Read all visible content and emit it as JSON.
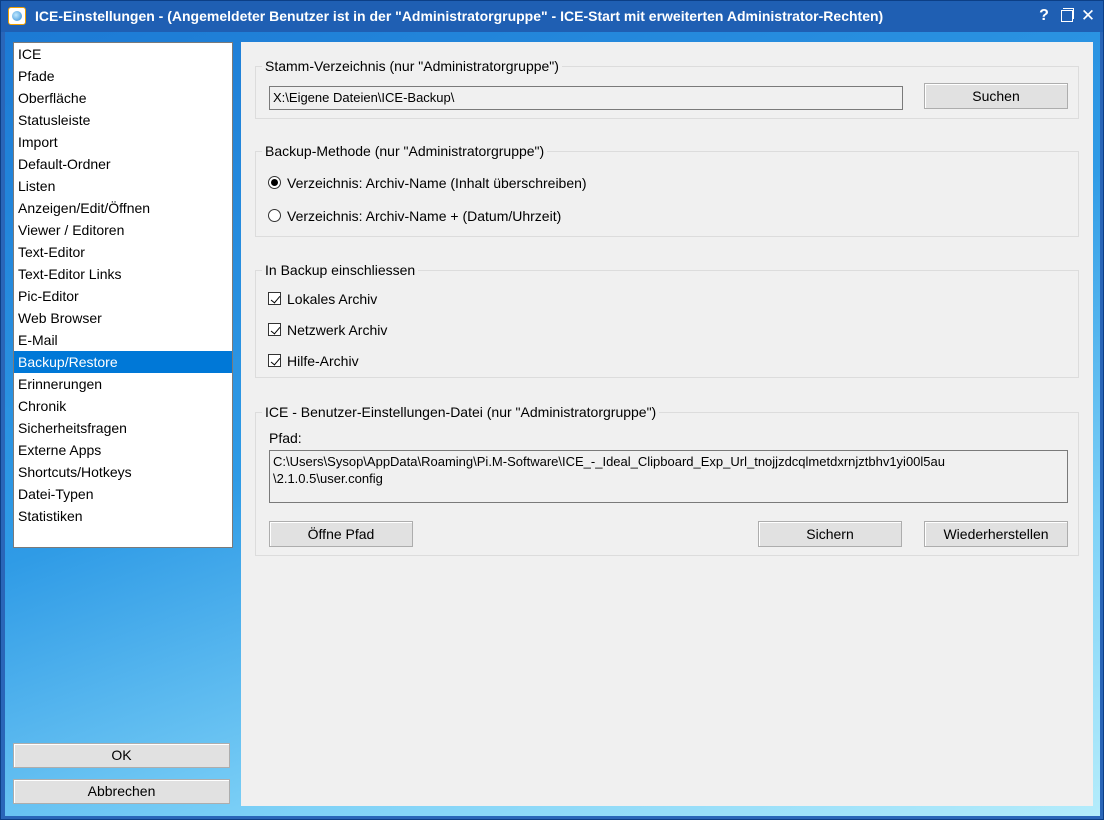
{
  "window": {
    "title": "ICE-Einstellungen - (Angemeldeter Benutzer ist in der \"Administratorgruppe\" - ICE-Start mit erweiterten Administrator-Rechten)",
    "icon": "app-icon",
    "help_glyph": "?",
    "close_glyph": "✕"
  },
  "sidebar": {
    "items": [
      {
        "label": "ICE"
      },
      {
        "label": "Pfade"
      },
      {
        "label": "Oberfläche"
      },
      {
        "label": "Statusleiste"
      },
      {
        "label": "Import"
      },
      {
        "label": "Default-Ordner"
      },
      {
        "label": "Listen"
      },
      {
        "label": "Anzeigen/Edit/Öffnen"
      },
      {
        "label": "Viewer / Editoren"
      },
      {
        "label": "Text-Editor"
      },
      {
        "label": "Text-Editor Links"
      },
      {
        "label": "Pic-Editor"
      },
      {
        "label": "Web Browser"
      },
      {
        "label": "E-Mail"
      },
      {
        "label": "Backup/Restore",
        "selected": true
      },
      {
        "label": "Erinnerungen"
      },
      {
        "label": "Chronik"
      },
      {
        "label": "Sicherheitsfragen"
      },
      {
        "label": "Externe Apps"
      },
      {
        "label": "Shortcuts/Hotkeys"
      },
      {
        "label": "Datei-Typen"
      },
      {
        "label": "Statistiken"
      }
    ],
    "ok_label": "OK",
    "cancel_label": "Abbrechen"
  },
  "stamm": {
    "title": "Stamm-Verzeichnis (nur \"Administratorgruppe\")",
    "path_value": "X:\\Eigene Dateien\\ICE-Backup\\",
    "search_label": "Suchen"
  },
  "method": {
    "title": "Backup-Methode (nur \"Administratorgruppe\")",
    "options": [
      {
        "label": "Verzeichnis: Archiv-Name (Inhalt überschreiben)",
        "checked": true
      },
      {
        "label": "Verzeichnis: Archiv-Name + (Datum/Uhrzeit)",
        "checked": false
      }
    ]
  },
  "include": {
    "title": "In Backup einschliessen",
    "items": [
      {
        "label": "Lokales Archiv",
        "checked": true
      },
      {
        "label": "Netzwerk Archiv",
        "checked": true
      },
      {
        "label": "Hilfe-Archiv",
        "checked": true
      }
    ]
  },
  "userfile": {
    "title": "ICE - Benutzer-Einstellungen-Datei (nur \"Administratorgruppe\")",
    "path_label": "Pfad:",
    "path_line1": "C:\\Users\\Sysop\\AppData\\Roaming\\Pi.M-Software\\ICE_-_Ideal_Clipboard_Exp_Url_tnojjzdcqlmetdxrnjztbhv1yi00l5au",
    "path_line2": "\\2.1.0.5\\user.config",
    "open_label": "Öffne Pfad",
    "save_label": "Sichern",
    "restore_label": "Wiederherstellen"
  }
}
